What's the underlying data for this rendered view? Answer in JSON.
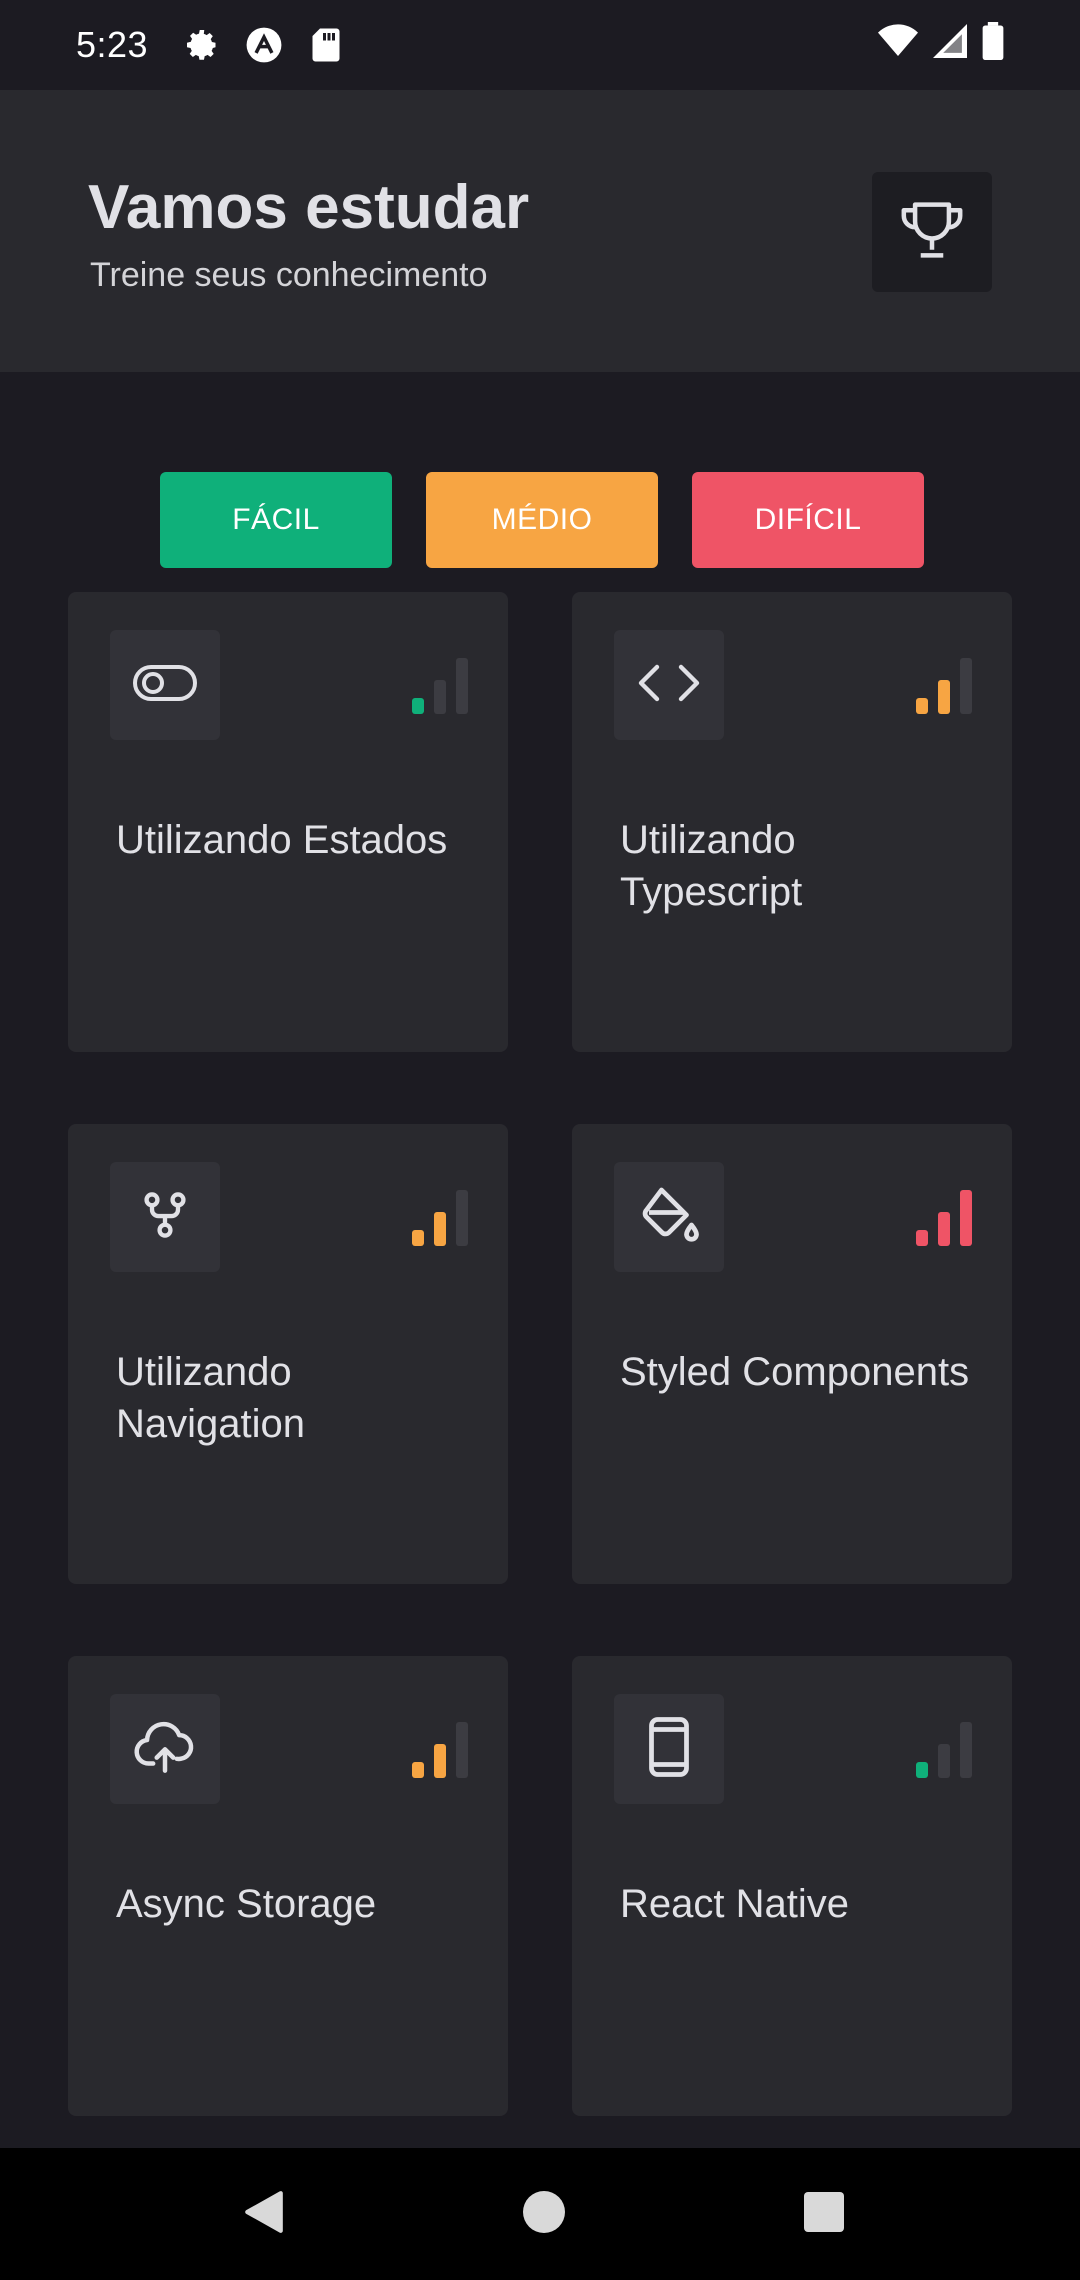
{
  "status_bar": {
    "time": "5:23",
    "left_icons": [
      "gear-icon",
      "app-a-icon",
      "sd-card-icon"
    ],
    "right_icons": [
      "wifi-icon",
      "signal-icon",
      "battery-icon"
    ]
  },
  "header": {
    "title": "Vamos estudar",
    "subtitle": "Treine seus conhecimento",
    "action_icon": "trophy-icon"
  },
  "filters": [
    {
      "label": "FÁCIL",
      "color": "#0fb07a"
    },
    {
      "label": "MÉDIO",
      "color": "#f7a543"
    },
    {
      "label": "DIFÍCIL",
      "color": "#ef5466"
    }
  ],
  "level_colors": {
    "easy": "#0fb07a",
    "medium": "#f7a543",
    "hard": "#ef5466",
    "inactive": "#3c3c42"
  },
  "cards": [
    {
      "title": "Utilizando Estados",
      "icon": "toggle-icon",
      "level": "easy",
      "level_value": 1
    },
    {
      "title": "Utilizando Typescript",
      "icon": "code-icon",
      "level": "medium",
      "level_value": 2
    },
    {
      "title": "Utilizando Navigation",
      "icon": "git-fork-icon",
      "level": "medium",
      "level_value": 2
    },
    {
      "title": "Styled Components",
      "icon": "paint-bucket-icon",
      "level": "hard",
      "level_value": 3
    },
    {
      "title": "Async Storage",
      "icon": "cloud-upload-icon",
      "level": "medium",
      "level_value": 2
    },
    {
      "title": "React Native",
      "icon": "smartphone-icon",
      "level": "easy",
      "level_value": 1
    }
  ],
  "nav_bar": [
    "back-icon",
    "home-icon",
    "recents-icon"
  ]
}
